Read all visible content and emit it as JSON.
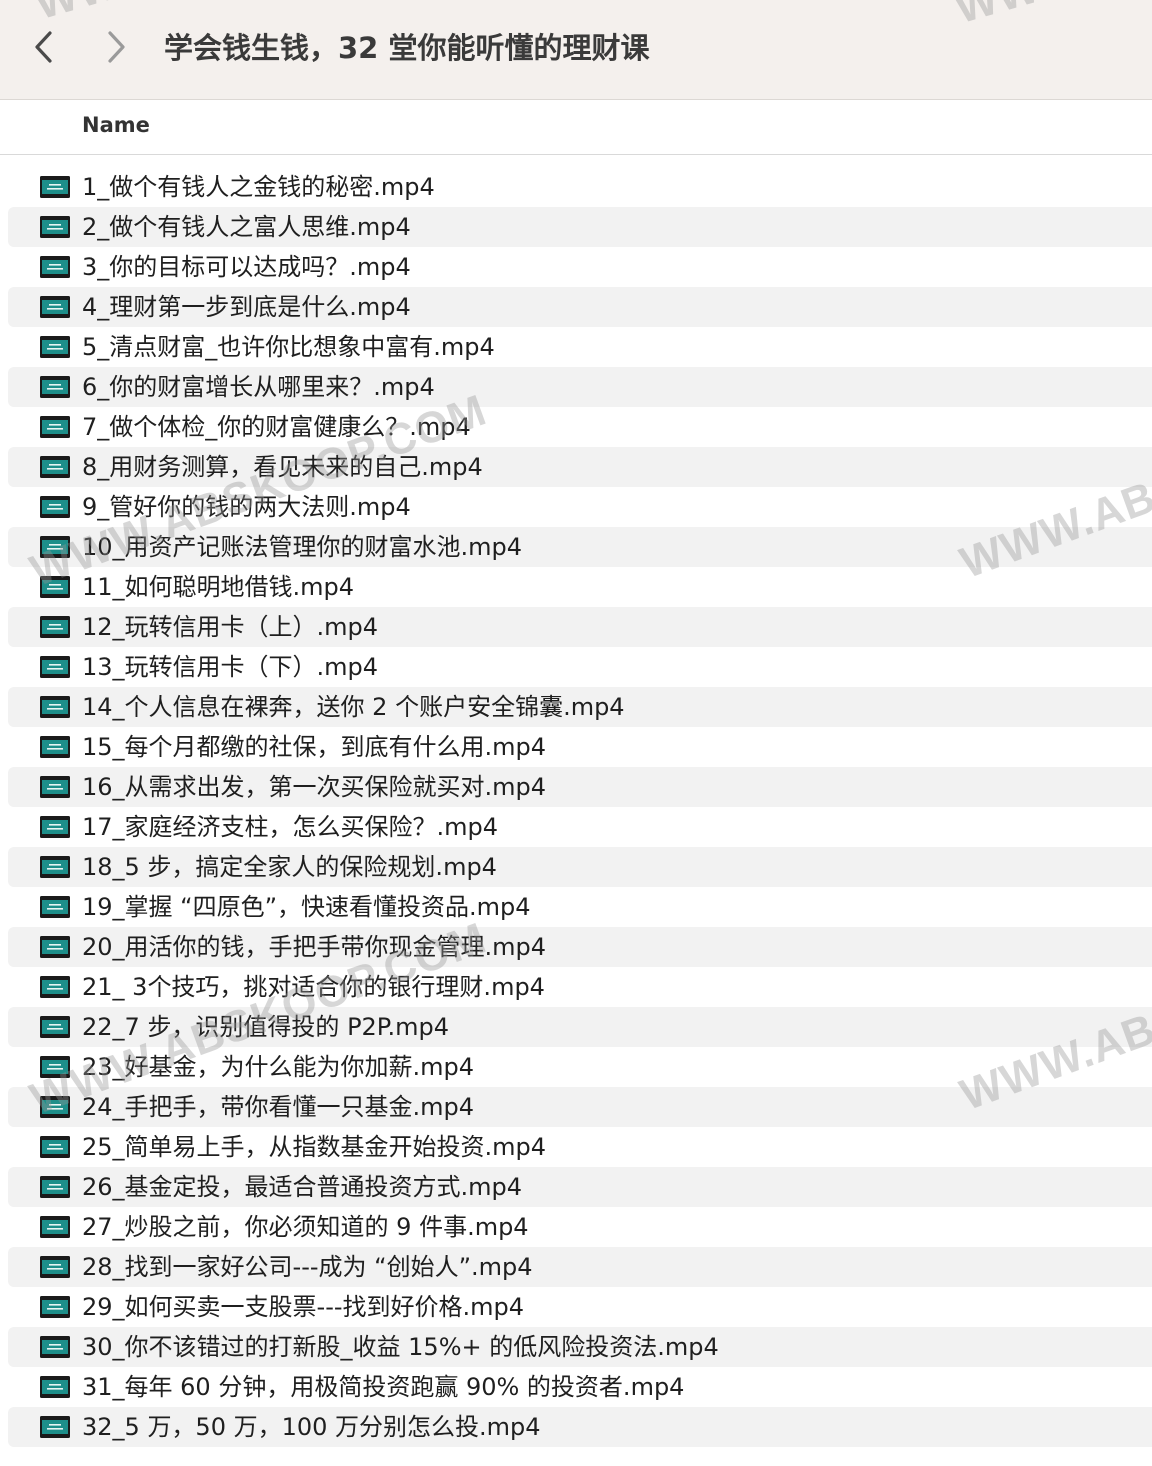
{
  "window": {
    "title": "学会钱生钱，32 堂你能听懂的理财课",
    "back_icon": "chevron-left-icon",
    "forward_icon": "chevron-right-icon"
  },
  "columns": {
    "name": "Name"
  },
  "colors": {
    "titlebar_bg": "#f4f0ed",
    "row_alt_bg": "#f2f2f2",
    "icon_teal": "#1e8f8a",
    "icon_dark": "#1a1a1a"
  },
  "file_icon": "video-file-icon",
  "files": [
    "1_做个有钱人之金钱的秘密.mp4",
    "2_做个有钱人之富人思维.mp4",
    "3_你的目标可以达成吗？.mp4",
    "4_理财第一步到底是什么.mp4",
    "5_清点财富_也许你比想象中富有.mp4",
    "6_你的财富增长从哪里来？.mp4",
    "7_做个体检_你的财富健康么？.mp4",
    "8_用财务测算，看见未来的自己.mp4",
    "9_管好你的钱的两大法则.mp4",
    "10_用资产记账法管理你的财富水池.mp4",
    "11_如何聪明地借钱.mp4",
    "12_玩转信用卡（上）.mp4",
    "13_玩转信用卡（下）.mp4",
    "14_个人信息在裸奔，送你 2 个账户安全锦囊.mp4",
    "15_每个月都缴的社保，到底有什么用.mp4",
    "16_从需求出发，第一次买保险就买对.mp4",
    "17_家庭经济支柱，怎么买保险？.mp4",
    "18_5 步，搞定全家人的保险规划.mp4",
    "19_掌握 “四原色”，快速看懂投资品.mp4",
    "20_用活你的钱，手把手带你现金管理.mp4",
    "21_ 3个技巧，挑对适合你的银行理财.mp4",
    "22_7 步，识别值得投的 P2P.mp4",
    "23_好基金，为什么能为你加薪.mp4",
    "24_手把手，带你看懂一只基金.mp4",
    "25_简单易上手，从指数基金开始投资.mp4",
    "26_基金定投，最适合普通投资方式.mp4",
    "27_炒股之前，你必须知道的 9 件事.mp4",
    "28_找到一家好公司---成为 “创始人”.mp4",
    "29_如何买卖一支股票---找到好价格.mp4",
    "30_你不该错过的打新股_收益 15%+ 的低风险投资法.mp4",
    "31_每年 60 分钟，用极简投资跑赢 90% 的投资者.mp4",
    "32_5 万，50 万，100 万分别怎么投.mp4"
  ],
  "watermarks": {
    "main": "WWW.ABSKOOP.COM",
    "edge": "WWW.ABS",
    "top": "WW"
  }
}
